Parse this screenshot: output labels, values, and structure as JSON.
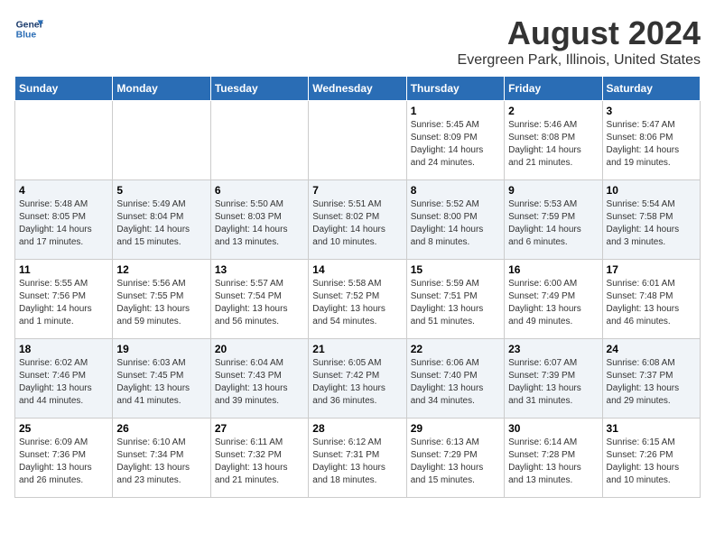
{
  "header": {
    "logo_line1": "General",
    "logo_line2": "Blue",
    "month_title": "August 2024",
    "location": "Evergreen Park, Illinois, United States"
  },
  "days_of_week": [
    "Sunday",
    "Monday",
    "Tuesday",
    "Wednesday",
    "Thursday",
    "Friday",
    "Saturday"
  ],
  "weeks": [
    [
      {
        "day": "",
        "info": ""
      },
      {
        "day": "",
        "info": ""
      },
      {
        "day": "",
        "info": ""
      },
      {
        "day": "",
        "info": ""
      },
      {
        "day": "1",
        "info": "Sunrise: 5:45 AM\nSunset: 8:09 PM\nDaylight: 14 hours\nand 24 minutes."
      },
      {
        "day": "2",
        "info": "Sunrise: 5:46 AM\nSunset: 8:08 PM\nDaylight: 14 hours\nand 21 minutes."
      },
      {
        "day": "3",
        "info": "Sunrise: 5:47 AM\nSunset: 8:06 PM\nDaylight: 14 hours\nand 19 minutes."
      }
    ],
    [
      {
        "day": "4",
        "info": "Sunrise: 5:48 AM\nSunset: 8:05 PM\nDaylight: 14 hours\nand 17 minutes."
      },
      {
        "day": "5",
        "info": "Sunrise: 5:49 AM\nSunset: 8:04 PM\nDaylight: 14 hours\nand 15 minutes."
      },
      {
        "day": "6",
        "info": "Sunrise: 5:50 AM\nSunset: 8:03 PM\nDaylight: 14 hours\nand 13 minutes."
      },
      {
        "day": "7",
        "info": "Sunrise: 5:51 AM\nSunset: 8:02 PM\nDaylight: 14 hours\nand 10 minutes."
      },
      {
        "day": "8",
        "info": "Sunrise: 5:52 AM\nSunset: 8:00 PM\nDaylight: 14 hours\nand 8 minutes."
      },
      {
        "day": "9",
        "info": "Sunrise: 5:53 AM\nSunset: 7:59 PM\nDaylight: 14 hours\nand 6 minutes."
      },
      {
        "day": "10",
        "info": "Sunrise: 5:54 AM\nSunset: 7:58 PM\nDaylight: 14 hours\nand 3 minutes."
      }
    ],
    [
      {
        "day": "11",
        "info": "Sunrise: 5:55 AM\nSunset: 7:56 PM\nDaylight: 14 hours\nand 1 minute."
      },
      {
        "day": "12",
        "info": "Sunrise: 5:56 AM\nSunset: 7:55 PM\nDaylight: 13 hours\nand 59 minutes."
      },
      {
        "day": "13",
        "info": "Sunrise: 5:57 AM\nSunset: 7:54 PM\nDaylight: 13 hours\nand 56 minutes."
      },
      {
        "day": "14",
        "info": "Sunrise: 5:58 AM\nSunset: 7:52 PM\nDaylight: 13 hours\nand 54 minutes."
      },
      {
        "day": "15",
        "info": "Sunrise: 5:59 AM\nSunset: 7:51 PM\nDaylight: 13 hours\nand 51 minutes."
      },
      {
        "day": "16",
        "info": "Sunrise: 6:00 AM\nSunset: 7:49 PM\nDaylight: 13 hours\nand 49 minutes."
      },
      {
        "day": "17",
        "info": "Sunrise: 6:01 AM\nSunset: 7:48 PM\nDaylight: 13 hours\nand 46 minutes."
      }
    ],
    [
      {
        "day": "18",
        "info": "Sunrise: 6:02 AM\nSunset: 7:46 PM\nDaylight: 13 hours\nand 44 minutes."
      },
      {
        "day": "19",
        "info": "Sunrise: 6:03 AM\nSunset: 7:45 PM\nDaylight: 13 hours\nand 41 minutes."
      },
      {
        "day": "20",
        "info": "Sunrise: 6:04 AM\nSunset: 7:43 PM\nDaylight: 13 hours\nand 39 minutes."
      },
      {
        "day": "21",
        "info": "Sunrise: 6:05 AM\nSunset: 7:42 PM\nDaylight: 13 hours\nand 36 minutes."
      },
      {
        "day": "22",
        "info": "Sunrise: 6:06 AM\nSunset: 7:40 PM\nDaylight: 13 hours\nand 34 minutes."
      },
      {
        "day": "23",
        "info": "Sunrise: 6:07 AM\nSunset: 7:39 PM\nDaylight: 13 hours\nand 31 minutes."
      },
      {
        "day": "24",
        "info": "Sunrise: 6:08 AM\nSunset: 7:37 PM\nDaylight: 13 hours\nand 29 minutes."
      }
    ],
    [
      {
        "day": "25",
        "info": "Sunrise: 6:09 AM\nSunset: 7:36 PM\nDaylight: 13 hours\nand 26 minutes."
      },
      {
        "day": "26",
        "info": "Sunrise: 6:10 AM\nSunset: 7:34 PM\nDaylight: 13 hours\nand 23 minutes."
      },
      {
        "day": "27",
        "info": "Sunrise: 6:11 AM\nSunset: 7:32 PM\nDaylight: 13 hours\nand 21 minutes."
      },
      {
        "day": "28",
        "info": "Sunrise: 6:12 AM\nSunset: 7:31 PM\nDaylight: 13 hours\nand 18 minutes."
      },
      {
        "day": "29",
        "info": "Sunrise: 6:13 AM\nSunset: 7:29 PM\nDaylight: 13 hours\nand 15 minutes."
      },
      {
        "day": "30",
        "info": "Sunrise: 6:14 AM\nSunset: 7:28 PM\nDaylight: 13 hours\nand 13 minutes."
      },
      {
        "day": "31",
        "info": "Sunrise: 6:15 AM\nSunset: 7:26 PM\nDaylight: 13 hours\nand 10 minutes."
      }
    ]
  ]
}
